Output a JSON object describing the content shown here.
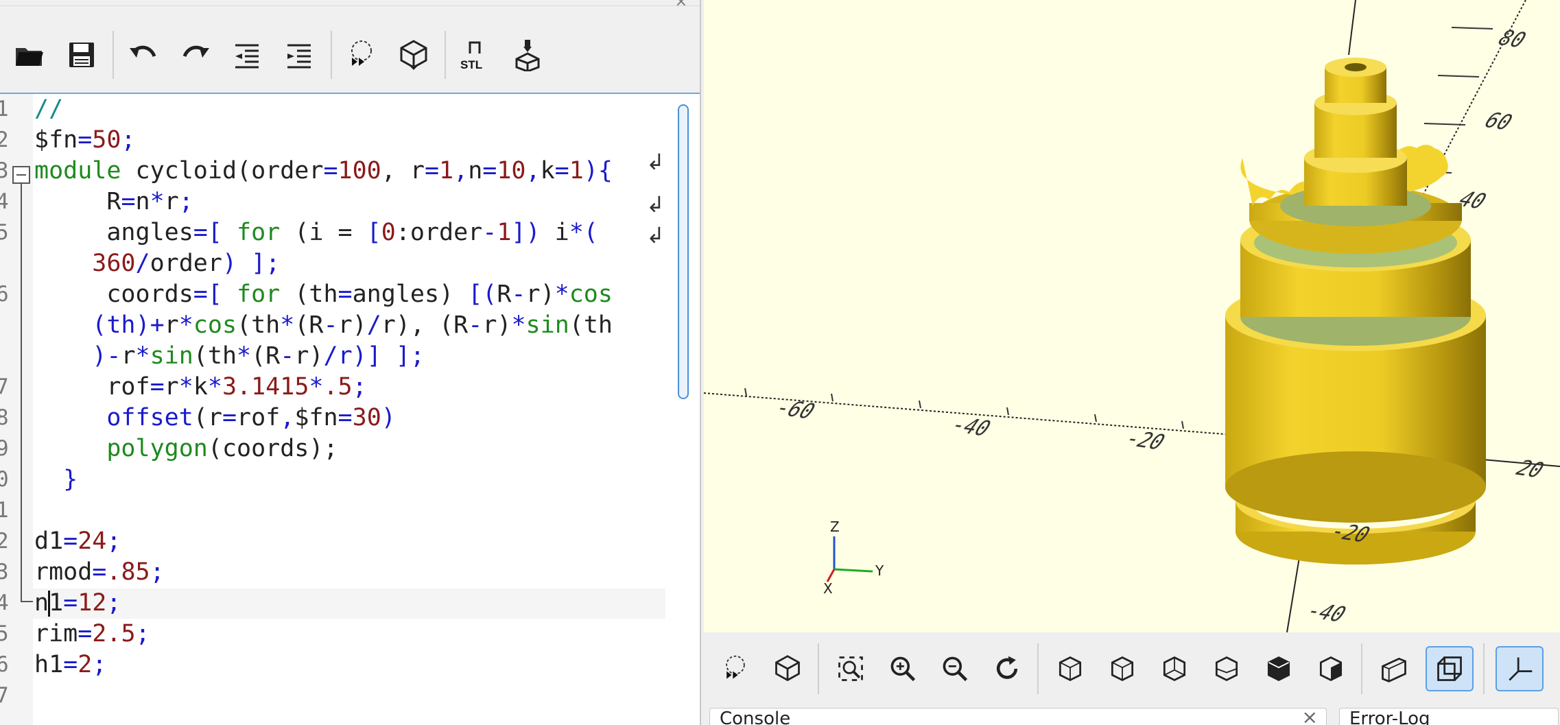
{
  "toolbar": {
    "buttons": [
      {
        "name": "open-file-icon"
      },
      {
        "name": "save-file-icon"
      },
      {
        "name": "undo-icon"
      },
      {
        "name": "redo-icon"
      },
      {
        "name": "unindent-icon"
      },
      {
        "name": "indent-icon"
      },
      {
        "name": "preview-icon"
      },
      {
        "name": "render-icon"
      },
      {
        "name": "export-stl-icon",
        "label": "STL"
      },
      {
        "name": "send-to-3d-print-icon"
      }
    ]
  },
  "editor": {
    "gutter_numbers": [
      "1",
      "2",
      "3",
      "4",
      "5",
      "",
      "6",
      "",
      "",
      "7",
      "8",
      "9",
      "0",
      "1",
      "2",
      "3",
      "4",
      "5",
      "6",
      "7"
    ],
    "lines": [
      [
        {
          "t": "//",
          "c": "comment"
        }
      ],
      [
        {
          "t": "$fn",
          "c": "txt"
        },
        {
          "t": "=",
          "c": "op"
        },
        {
          "t": "50",
          "c": "num"
        },
        {
          "t": ";",
          "c": "op"
        }
      ],
      [
        {
          "t": "module",
          "c": "kw"
        },
        {
          "t": " cycloid(order",
          "c": "txt"
        },
        {
          "t": "=",
          "c": "op"
        },
        {
          "t": "100",
          "c": "num"
        },
        {
          "t": ", r",
          "c": "txt"
        },
        {
          "t": "=",
          "c": "op"
        },
        {
          "t": "1",
          "c": "num"
        },
        {
          "t": ",",
          "c": "op"
        },
        {
          "t": "n",
          "c": "txt"
        },
        {
          "t": "=",
          "c": "op"
        },
        {
          "t": "10",
          "c": "num"
        },
        {
          "t": ",",
          "c": "op"
        },
        {
          "t": "k",
          "c": "txt"
        },
        {
          "t": "=",
          "c": "op"
        },
        {
          "t": "1",
          "c": "num"
        },
        {
          "t": "){",
          "c": "op"
        }
      ],
      [
        {
          "t": "     R",
          "c": "txt"
        },
        {
          "t": "=",
          "c": "op"
        },
        {
          "t": "n",
          "c": "txt"
        },
        {
          "t": "*",
          "c": "op"
        },
        {
          "t": "r",
          "c": "txt"
        },
        {
          "t": ";",
          "c": "op"
        }
      ],
      [
        {
          "t": "     angles",
          "c": "txt"
        },
        {
          "t": "=[",
          "c": "op"
        },
        {
          "t": " for ",
          "c": "kw"
        },
        {
          "t": "(i = ",
          "c": "txt"
        },
        {
          "t": "[",
          "c": "op"
        },
        {
          "t": "0",
          "c": "num"
        },
        {
          "t": ":order",
          "c": "txt"
        },
        {
          "t": "-",
          "c": "op"
        },
        {
          "t": "1",
          "c": "num"
        },
        {
          "t": "])",
          "c": "op"
        },
        {
          "t": " i",
          "c": "txt"
        },
        {
          "t": "*(",
          "c": "op"
        }
      ],
      [
        {
          "t": "    360",
          "c": "num"
        },
        {
          "t": "/",
          "c": "op"
        },
        {
          "t": "order",
          "c": "txt"
        },
        {
          "t": ") ];",
          "c": "op"
        }
      ],
      [
        {
          "t": "     coords",
          "c": "txt"
        },
        {
          "t": "=[",
          "c": "op"
        },
        {
          "t": " for ",
          "c": "kw"
        },
        {
          "t": "(th",
          "c": "txt"
        },
        {
          "t": "=",
          "c": "op"
        },
        {
          "t": "angles) ",
          "c": "txt"
        },
        {
          "t": "[(",
          "c": "op"
        },
        {
          "t": "R",
          "c": "txt"
        },
        {
          "t": "-",
          "c": "op"
        },
        {
          "t": "r)",
          "c": "txt"
        },
        {
          "t": "*",
          "c": "op"
        },
        {
          "t": "cos",
          "c": "kw"
        }
      ],
      [
        {
          "t": "    (th)",
          "c": "op"
        },
        {
          "t": "+",
          "c": "op"
        },
        {
          "t": "r",
          "c": "txt"
        },
        {
          "t": "*",
          "c": "op"
        },
        {
          "t": "cos",
          "c": "kw"
        },
        {
          "t": "(th",
          "c": "txt"
        },
        {
          "t": "*",
          "c": "op"
        },
        {
          "t": "(R",
          "c": "txt"
        },
        {
          "t": "-",
          "c": "op"
        },
        {
          "t": "r)",
          "c": "txt"
        },
        {
          "t": "/",
          "c": "op"
        },
        {
          "t": "r), (R",
          "c": "txt"
        },
        {
          "t": "-",
          "c": "op"
        },
        {
          "t": "r)",
          "c": "txt"
        },
        {
          "t": "*",
          "c": "op"
        },
        {
          "t": "sin",
          "c": "kw"
        },
        {
          "t": "(th",
          "c": "txt"
        }
      ],
      [
        {
          "t": "    )",
          "c": "op"
        },
        {
          "t": "-",
          "c": "op"
        },
        {
          "t": "r",
          "c": "txt"
        },
        {
          "t": "*",
          "c": "op"
        },
        {
          "t": "sin",
          "c": "kw"
        },
        {
          "t": "(th",
          "c": "txt"
        },
        {
          "t": "*",
          "c": "op"
        },
        {
          "t": "(R",
          "c": "txt"
        },
        {
          "t": "-",
          "c": "op"
        },
        {
          "t": "r)",
          "c": "txt"
        },
        {
          "t": "/",
          "c": "op"
        },
        {
          "t": "r)] ];",
          "c": "op"
        }
      ],
      [
        {
          "t": "     rof",
          "c": "txt"
        },
        {
          "t": "=",
          "c": "op"
        },
        {
          "t": "r",
          "c": "txt"
        },
        {
          "t": "*",
          "c": "op"
        },
        {
          "t": "k",
          "c": "txt"
        },
        {
          "t": "*",
          "c": "op"
        },
        {
          "t": "3.1415",
          "c": "num"
        },
        {
          "t": "*",
          "c": "op"
        },
        {
          "t": ".5",
          "c": "num"
        },
        {
          "t": ";",
          "c": "op"
        }
      ],
      [
        {
          "t": "     offset",
          "c": "op"
        },
        {
          "t": "(r",
          "c": "txt"
        },
        {
          "t": "=",
          "c": "op"
        },
        {
          "t": "rof",
          "c": "txt"
        },
        {
          "t": ",",
          "c": "op"
        },
        {
          "t": "$fn",
          "c": "txt"
        },
        {
          "t": "=",
          "c": "op"
        },
        {
          "t": "30",
          "c": "num"
        },
        {
          "t": ")",
          "c": "op"
        }
      ],
      [
        {
          "t": "     polygon",
          "c": "kw"
        },
        {
          "t": "(coords);",
          "c": "txt"
        }
      ],
      [
        {
          "t": "  }",
          "c": "op"
        }
      ],
      [
        {
          "t": "",
          "c": "txt"
        }
      ],
      [
        {
          "t": "d1",
          "c": "txt"
        },
        {
          "t": "=",
          "c": "op"
        },
        {
          "t": "24",
          "c": "num"
        },
        {
          "t": ";",
          "c": "op"
        }
      ],
      [
        {
          "t": "rmod",
          "c": "txt"
        },
        {
          "t": "=",
          "c": "op"
        },
        {
          "t": ".85",
          "c": "num"
        },
        {
          "t": ";",
          "c": "op"
        }
      ],
      [
        {
          "t": "n1",
          "c": "txt"
        },
        {
          "t": "=",
          "c": "op"
        },
        {
          "t": "12",
          "c": "num"
        },
        {
          "t": ";",
          "c": "op"
        }
      ],
      [
        {
          "t": "rim",
          "c": "txt"
        },
        {
          "t": "=",
          "c": "op"
        },
        {
          "t": "2.5",
          "c": "num"
        },
        {
          "t": ";",
          "c": "op"
        }
      ],
      [
        {
          "t": "h1",
          "c": "txt"
        },
        {
          "t": "=",
          "c": "op"
        },
        {
          "t": "2",
          "c": "num"
        },
        {
          "t": ";",
          "c": "op"
        }
      ]
    ]
  },
  "viewport": {
    "background": "#ffffe5",
    "model_color": "#f1cf2a",
    "axis_labels": [
      "-60",
      "-40",
      "-20",
      "20",
      "80",
      "60",
      "40",
      "-20",
      "-40"
    ],
    "gizmo": {
      "z": "Z",
      "y": "Y",
      "x": "X"
    }
  },
  "viewport_toolbar": {
    "buttons": [
      "preview-icon",
      "render-icon",
      "zoom-all-icon",
      "zoom-in-icon",
      "zoom-out-icon",
      "reset-view-icon",
      "view-right-icon",
      "view-top-icon",
      "view-bottom-icon",
      "view-left-icon",
      "view-front-icon",
      "view-back-icon",
      "perspective-icon",
      "orthogonal-icon",
      "show-axes-icon"
    ]
  },
  "dock": {
    "left_tab": "Console",
    "right_tab": "Error-Log"
  }
}
